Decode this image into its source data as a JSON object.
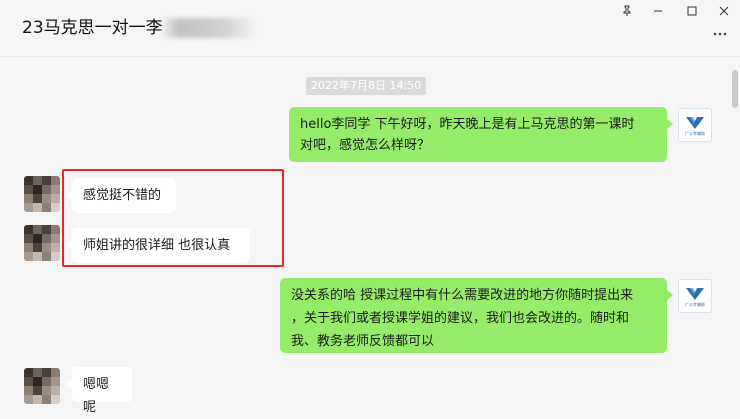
{
  "window": {
    "title": "23马克思一对一李",
    "pin_icon": "pin-icon",
    "minimize_icon": "minimize-icon",
    "maximize_icon": "maximize-icon",
    "close_icon": "close-icon",
    "more_icon": "more-icon"
  },
  "chat": {
    "timestamp": "2022年7月8日 14:50",
    "messages": [
      {
        "side": "me",
        "line1": "hello李同学 下午好呀，昨天晚上是有上马克思的第一课时",
        "line2": "对吧，感觉怎么样呀？"
      },
      {
        "side": "other",
        "text": "感觉挺不错的"
      },
      {
        "side": "other",
        "text": "师姐讲的很详细 也很认真"
      },
      {
        "side": "me",
        "line1": "没关系的哈 授课过程中有什么需要改进的地方你随时提出来",
        "line2": "，关于我们或者授课学姐的建议，我们也会改进的。随时和",
        "line3": "我、教务老师反馈都可以"
      },
      {
        "side": "other",
        "text": "嗯嗯呢"
      }
    ],
    "logo_caption": "广公考辅助"
  },
  "colors": {
    "self_bubble": "#95ec69",
    "other_bubble": "#ffffff",
    "highlight": "#e5262a",
    "background": "#f5f5f5"
  }
}
